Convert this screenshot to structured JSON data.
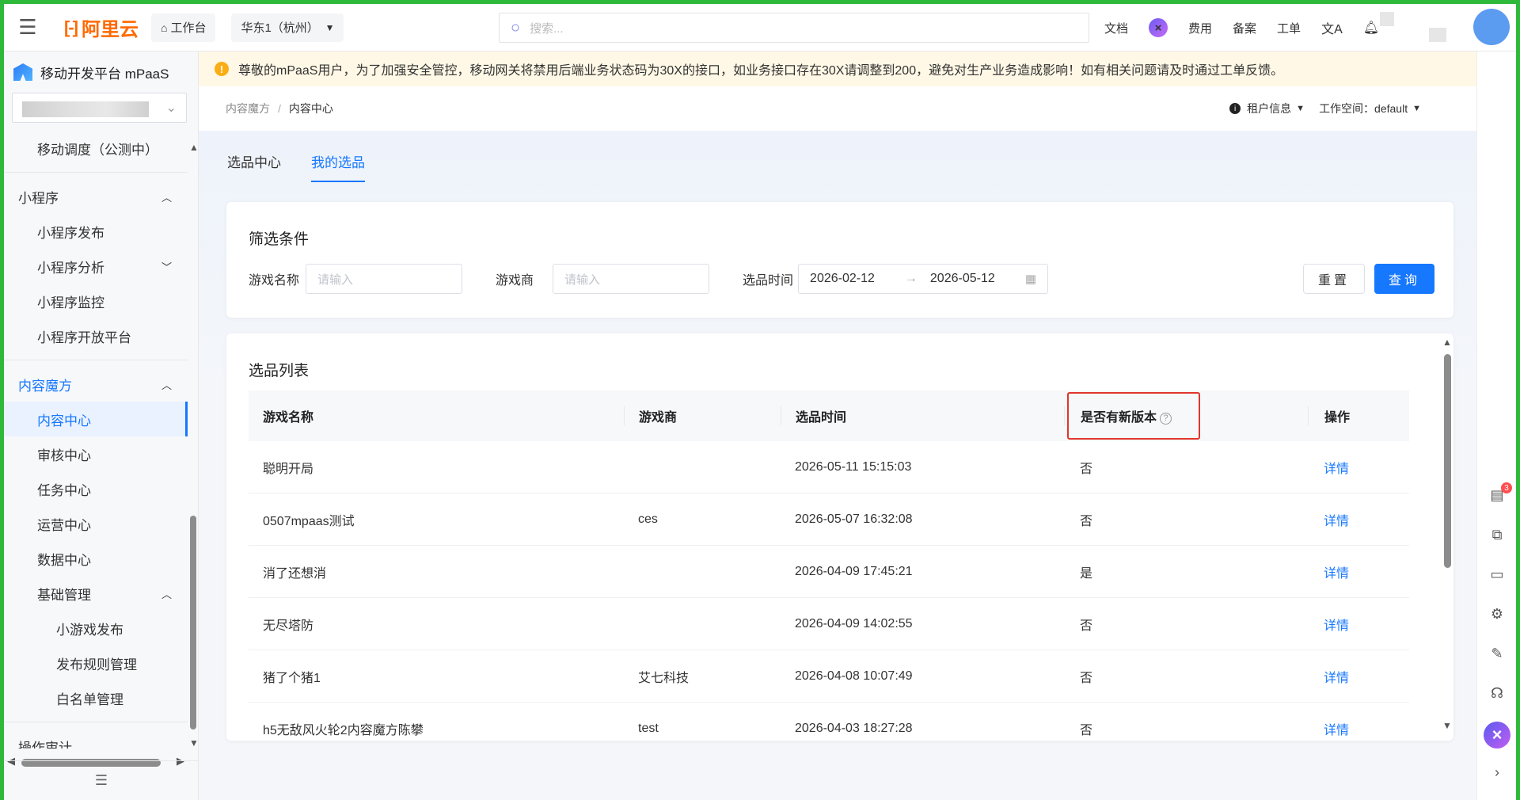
{
  "topbar": {
    "logo_text": "阿里云",
    "workbench": "工作台",
    "region": "华东1（杭州）",
    "search_placeholder": "搜索...",
    "nav": [
      "文档",
      "费用",
      "备案",
      "工单"
    ]
  },
  "sidebar": {
    "product": "移动开发平台 mPaaS",
    "items": [
      {
        "label": "移动调度（公测中）",
        "level": 2
      },
      {
        "label": "小程序",
        "level": 1,
        "arrow": "up"
      },
      {
        "label": "小程序发布",
        "level": 2
      },
      {
        "label": "小程序分析",
        "level": 2,
        "arrow": "down"
      },
      {
        "label": "小程序监控",
        "level": 2
      },
      {
        "label": "小程序开放平台",
        "level": 2
      },
      {
        "label": "内容魔方",
        "level": 1,
        "arrow": "up",
        "active_group": true
      },
      {
        "label": "内容中心",
        "level": 2,
        "active": true
      },
      {
        "label": "审核中心",
        "level": 2
      },
      {
        "label": "任务中心",
        "level": 2
      },
      {
        "label": "运营中心",
        "level": 2
      },
      {
        "label": "数据中心",
        "level": 2
      },
      {
        "label": "基础管理",
        "level": 2,
        "arrow": "up"
      },
      {
        "label": "小游戏发布",
        "level": 3
      },
      {
        "label": "发布规则管理",
        "level": 3
      },
      {
        "label": "白名单管理",
        "level": 3
      },
      {
        "label": "操作审计",
        "level": 1
      }
    ]
  },
  "notice": "尊敬的mPaaS用户，为了加强安全管控，移动网关将禁用后端业务状态码为30X的接口，如业务接口存在30X请调整到200，避免对生产业务造成影响！如有相关问题请及时通过工单反馈。",
  "breadcrumb": {
    "parent": "内容魔方",
    "sep": "/",
    "current": "内容中心"
  },
  "tenant": {
    "info": "租户信息",
    "workspace": "工作空间：default"
  },
  "tabs": [
    "选品中心",
    "我的选品"
  ],
  "filter": {
    "title": "筛选条件",
    "game_label": "游戏名称",
    "game_placeholder": "请输入",
    "vendor_label": "游戏商",
    "vendor_placeholder": "请输入",
    "time_label": "选品时间",
    "start": "2026-02-12",
    "end": "2026-05-12",
    "reset": "重置",
    "query": "查询"
  },
  "list": {
    "title": "选品列表",
    "headers": [
      "游戏名称",
      "游戏商",
      "选品时间",
      "是否有新版本",
      "操作"
    ],
    "rows": [
      {
        "name": "聪明开局",
        "vendor": "",
        "time": "2026-05-11 15:15:03",
        "newver": "否",
        "action": "详情"
      },
      {
        "name": "0507mpaas测试",
        "vendor": "ces",
        "time": "2026-05-07 16:32:08",
        "newver": "否",
        "action": "详情"
      },
      {
        "name": "消了还想消",
        "vendor": "",
        "time": "2026-04-09 17:45:21",
        "newver": "是",
        "action": "详情"
      },
      {
        "name": "无尽塔防",
        "vendor": "",
        "time": "2026-04-09 14:02:55",
        "newver": "否",
        "action": "详情"
      },
      {
        "name": "猪了个猪1",
        "vendor": "艾七科技",
        "time": "2026-04-08 10:07:49",
        "newver": "否",
        "action": "详情"
      },
      {
        "name": "h5无敌风火轮2内容魔方陈攀",
        "vendor": "test",
        "time": "2026-04-03 18:27:28",
        "newver": "否",
        "action": "详情"
      }
    ]
  },
  "rail": {
    "badge": "3"
  }
}
